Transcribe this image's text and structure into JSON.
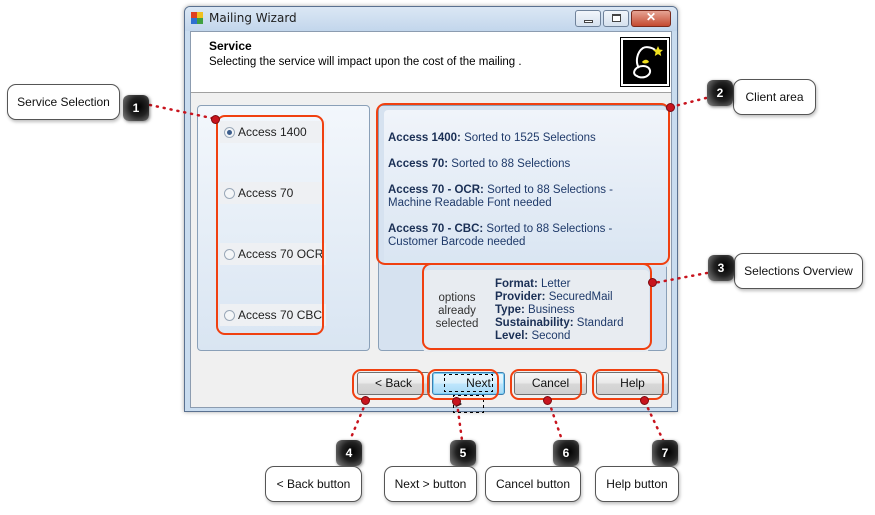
{
  "window": {
    "title": "Mailing Wizard",
    "controls": {
      "minimize": "minimize",
      "maximize": "maximize",
      "close": "close"
    }
  },
  "header": {
    "title": "Service",
    "subtitle": "Selecting the service will impact upon the cost of the mailing ."
  },
  "services": [
    {
      "label": "Access 1400",
      "checked": true
    },
    {
      "label": "Access 70",
      "checked": false
    },
    {
      "label": "Access 70 OCR",
      "checked": false
    },
    {
      "label": "Access 70 CBC",
      "checked": false
    }
  ],
  "descriptions": [
    {
      "name": "Access 1400:",
      "text": " Sorted to 1525 Selections"
    },
    {
      "name": "Access 70:",
      "text": " Sorted to 88 Selections"
    },
    {
      "name": "Access 70 - OCR:",
      "text": " Sorted to 88 Selections - Machine Readable Font needed"
    },
    {
      "name": "Access 70 - CBC:",
      "text": " Sorted to 88 Selections - Customer Barcode needed"
    }
  ],
  "overview": {
    "caption": "options already selected",
    "items": [
      {
        "key": "Format:",
        "value": " Letter"
      },
      {
        "key": "Provider:",
        "value": " SecuredMail"
      },
      {
        "key": "Type:",
        "value": " Business"
      },
      {
        "key": "Sustainability:",
        "value": " Standard"
      },
      {
        "key": "Level:",
        "value": " Second"
      }
    ]
  },
  "buttons": {
    "back": "< Back",
    "next": "Next >",
    "cancel": "Cancel",
    "help": "Help"
  },
  "annotations": [
    {
      "number": "1",
      "label": "Service Selection"
    },
    {
      "number": "2",
      "label": "Client area"
    },
    {
      "number": "3",
      "label": "Selections Overview"
    },
    {
      "number": "4",
      "label": "< Back button"
    },
    {
      "number": "5",
      "label": "Next > button"
    },
    {
      "number": "6",
      "label": "Cancel button"
    },
    {
      "number": "7",
      "label": "Help button"
    }
  ],
  "colors": {
    "highlight": "#f04010",
    "leader": "#c8141e",
    "description_text": "#1f3a6a"
  }
}
